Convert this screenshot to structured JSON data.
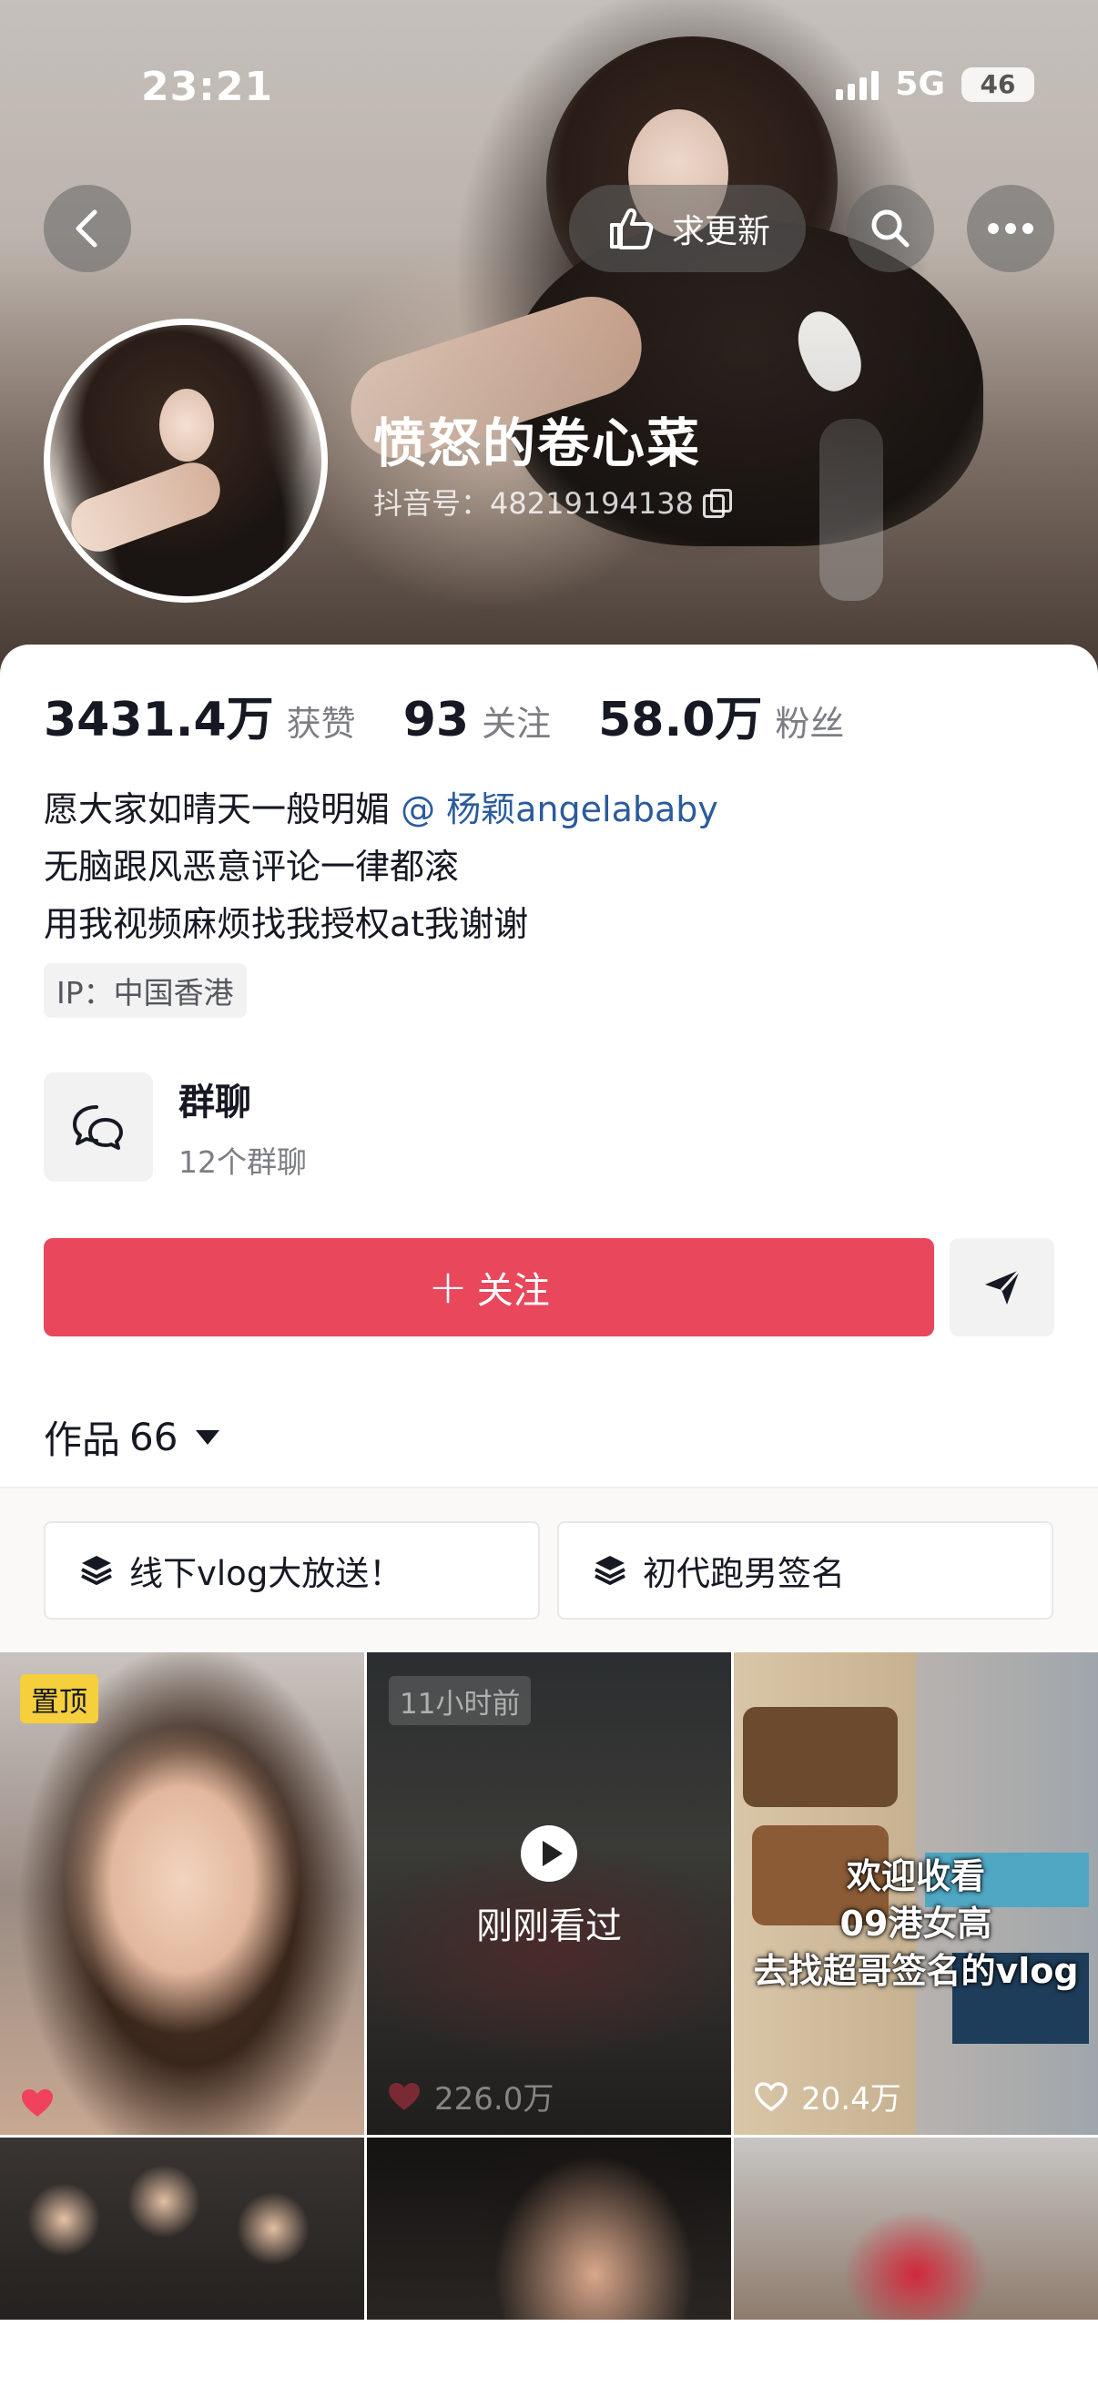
{
  "status_bar": {
    "time": "23:21",
    "network": "5G",
    "battery": "46"
  },
  "header": {
    "request_update_label": "求更新",
    "name": "愤怒的卷心菜",
    "douyin_id": "抖音号：48219194138"
  },
  "stats": [
    {
      "value": "3431.4万",
      "label": "获赞"
    },
    {
      "value": "93",
      "label": "关注"
    },
    {
      "value": "58.0万",
      "label": "粉丝"
    }
  ],
  "bio": {
    "line1_text": "愿大家如晴天一般明媚 ",
    "line1_mention": "@ 杨颖angelababy",
    "line2": "无脑跟风恶意评论一律都滚",
    "line3": "用我视频麻烦找我授权at我谢谢"
  },
  "ip": "IP：中国香港",
  "group_chat": {
    "title": "群聊",
    "subtitle": "12个群聊"
  },
  "actions": {
    "follow_label": "关注"
  },
  "works": {
    "label": "作品",
    "count": "66"
  },
  "collections": [
    {
      "label": "线下vlog大放送！"
    },
    {
      "label": "初代跑男签名"
    }
  ],
  "videos": [
    {
      "badge": "置顶",
      "likes": "",
      "liked": true
    },
    {
      "time_badge": "11小时前",
      "watched_label": "刚刚看过",
      "likes": "226.0万",
      "liked": true
    },
    {
      "overlay_lines": [
        "欢迎收看",
        "09港女高",
        "去找超哥签名的vlog"
      ],
      "likes": "20.4万",
      "liked": false
    }
  ],
  "colors": {
    "follow": "#e8475c",
    "pin_badge": "#f5cf3c",
    "mention": "#2b5b9c",
    "like_heart": "#f0415d"
  }
}
